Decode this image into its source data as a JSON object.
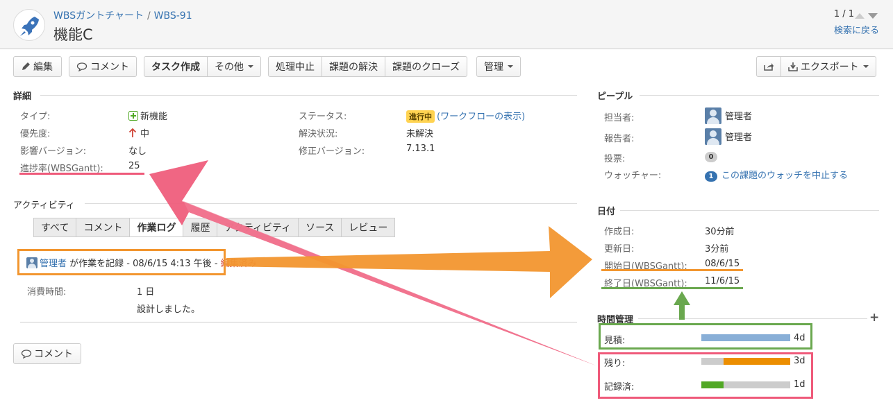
{
  "header": {
    "breadcrumb_project": "WBSガントチャート",
    "breadcrumb_sep": "/",
    "breadcrumb_issue": "WBS-91",
    "title": "機能C",
    "pager": "1 / 1",
    "back_to_search": "検索に戻る"
  },
  "toolbar": {
    "edit": "編集",
    "comment": "コメント",
    "create_task": "タスク作成",
    "more": "その他",
    "stop_progress": "処理中止",
    "resolve": "課題の解決",
    "close": "課題のクローズ",
    "admin": "管理",
    "export": "エクスポート"
  },
  "details": {
    "heading": "詳細",
    "type_label": "タイプ:",
    "type_value": "新機能",
    "priority_label": "優先度:",
    "priority_value": "中",
    "affects_label": "影響バージョン:",
    "affects_value": "なし",
    "progress_label": "進捗率(WBSGantt):",
    "progress_value": "25",
    "status_label": "ステータス:",
    "status_value": "進行中",
    "workflow_link": "(ワークフローの表示)",
    "resolution_label": "解決状況:",
    "resolution_value": "未解決",
    "fix_label": "修正バージョン:",
    "fix_value": "7.13.1"
  },
  "activity": {
    "heading": "アクティビティ",
    "tabs": [
      "すべて",
      "コメント",
      "作業ログ",
      "履歴",
      "アクティビティ",
      "ソース",
      "レビュー"
    ],
    "active_tab": "作業ログ",
    "worklog_user": "管理者",
    "worklog_text": "が作業を記録 - 08/6/15 4:13 午後 -",
    "worklog_edited": "編集済み",
    "time_spent_label": "消費時間:",
    "time_spent_value": "1 日",
    "worklog_comment": "設計しました。",
    "comment_button": "コメント"
  },
  "people": {
    "heading": "ピープル",
    "assignee_label": "担当者:",
    "assignee_value": "管理者",
    "reporter_label": "報告者:",
    "reporter_value": "管理者",
    "votes_label": "投票:",
    "votes_count": "0",
    "watchers_label": "ウォッチャー:",
    "watchers_count": "1",
    "watch_link": "この課題のウォッチを中止する"
  },
  "dates": {
    "heading": "日付",
    "created_label": "作成日:",
    "created_value": "30分前",
    "updated_label": "更新日:",
    "updated_value": "3分前",
    "start_label": "開始日(WBSGantt):",
    "start_value": "08/6/15",
    "end_label": "終了日(WBSGantt):",
    "end_value": "11/6/15"
  },
  "time_tracking": {
    "heading": "時間管理",
    "add_icon": "+",
    "estimated_label": "見積:",
    "estimated_value": "4d",
    "estimated_fraction": 1.0,
    "remaining_label": "残り:",
    "remaining_value": "3d",
    "remaining_fraction": 0.75,
    "logged_label": "記録済:",
    "logged_value": "1d",
    "logged_fraction": 0.25
  },
  "colors": {
    "link": "#3572b0",
    "estimate_bar": "#89afd7",
    "remaining_bar": "#ec8e00",
    "logged_bar": "#51a825",
    "bar_track": "#cccccc",
    "annotation_pink": "#ef5a7a",
    "annotation_orange": "#f2962f",
    "annotation_green": "#6aa84f"
  },
  "icons": {
    "project": "rocket-icon",
    "edit": "pencil-icon",
    "comment": "speech-bubble-icon",
    "type": "new-feature-icon",
    "priority": "arrow-up-icon",
    "share": "share-icon",
    "export": "download-icon",
    "user": "user-avatar-icon"
  }
}
